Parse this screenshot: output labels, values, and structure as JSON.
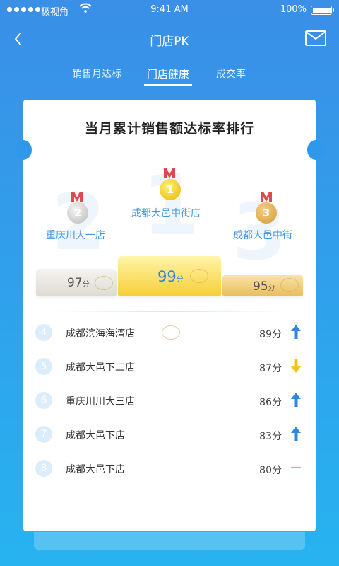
{
  "status_bar": {
    "carrier": "极视角",
    "time": "9:41 AM",
    "battery": "100%"
  },
  "nav": {
    "title": "门店PK"
  },
  "tabs": [
    {
      "label": "销售月达标",
      "active": false
    },
    {
      "label": "门店健康",
      "active": true
    },
    {
      "label": "成交率",
      "active": false
    }
  ],
  "card": {
    "heading": "当月累计销售额达标率排行"
  },
  "podium": {
    "first": {
      "rank": "1",
      "name": "成都大邑中街店",
      "score": "99",
      "unit": "分"
    },
    "second": {
      "rank": "2",
      "name": "重庆川大一店",
      "score": "97",
      "unit": "分"
    },
    "third": {
      "rank": "3",
      "name": "成都大邑中街",
      "score": "95",
      "unit": "分"
    }
  },
  "ranking": [
    {
      "rank": "4",
      "name": "成都滨海海湾店",
      "score": "89分",
      "trend": "up"
    },
    {
      "rank": "5",
      "name": "成都大邑下二店",
      "score": "87分",
      "trend": "down"
    },
    {
      "rank": "6",
      "name": "重庆川川大三店",
      "score": "86分",
      "trend": "up"
    },
    {
      "rank": "7",
      "name": "成都大邑下店",
      "score": "83分",
      "trend": "up"
    },
    {
      "rank": "8",
      "name": "成都大邑下店",
      "score": "80分",
      "trend": "flat"
    }
  ],
  "colors": {
    "accent": "#3a8fe6",
    "up": "#2f86de",
    "down": "#f5c21a",
    "flat": "#f5a623"
  }
}
